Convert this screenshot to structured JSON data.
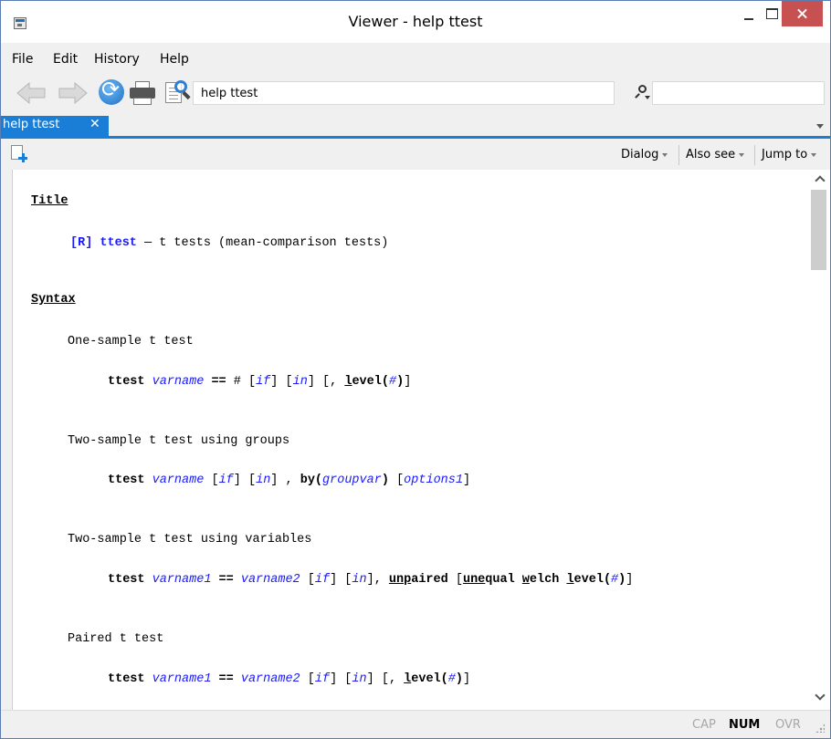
{
  "window": {
    "title": "Viewer - help ttest"
  },
  "menubar": {
    "items": [
      "File",
      "Edit",
      "History",
      "Help"
    ]
  },
  "toolbar": {
    "command_value": "help ttest",
    "search_value": ""
  },
  "tabs": [
    {
      "label": "help ttest",
      "close": "✕",
      "active": true
    }
  ],
  "subbar": {
    "dialog_label": "Dialog",
    "also_see_label": "Also see",
    "jump_to_label": "Jump to"
  },
  "help": {
    "title_heading": "Title",
    "title_link": "[R] ttest",
    "title_desc": " — t tests (mean-comparison tests)",
    "syntax_heading": "Syntax",
    "one_sample_label": "One-sample t test",
    "two_sample_groups_label": "Two-sample t test using groups",
    "two_sample_vars_label": "Two-sample t test using variables",
    "paired_label": "Paired t test",
    "cmd": "ttest",
    "varname": "varname",
    "varname1": "varname1",
    "varname2": "varname2",
    "eqeq": " == ",
    "hash": "#",
    "if_open": "[",
    "if_word": "if",
    "in_word": "in",
    "close_br": "]",
    "by_word": "by",
    "groupvar": "groupvar",
    "options1": "options1",
    "unpaired_u": "unp",
    "unpaired_rest": "aired",
    "unequal_u": "une",
    "unequal_rest": "qual",
    "welch_u": "w",
    "welch_rest": "elch",
    "level_u": "l",
    "level_rest": "evel"
  },
  "status": {
    "cap": "CAP",
    "num": "NUM",
    "ovr": "OVR"
  },
  "colors": {
    "accent": "#1a7ed6",
    "link": "#1a1aff",
    "close_button": "#c75050"
  }
}
